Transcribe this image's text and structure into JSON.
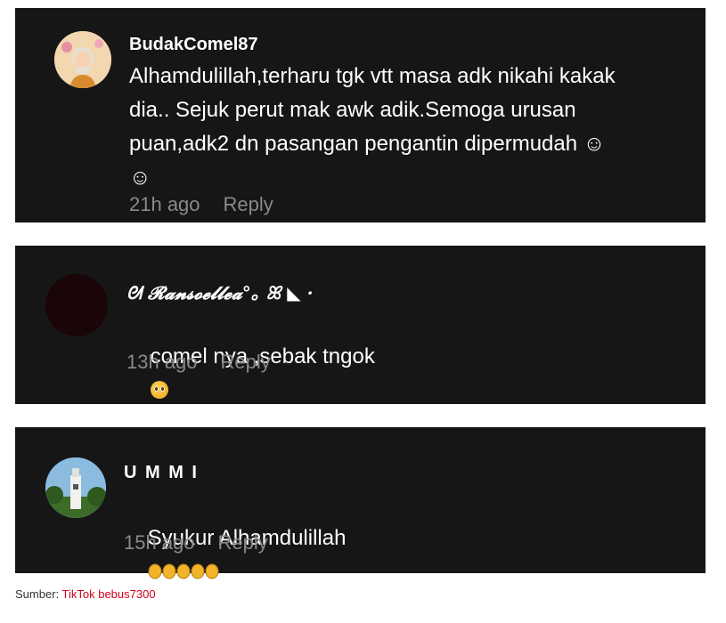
{
  "comments": [
    {
      "username": "BudakComel87",
      "text": "Alhamdulillah,terharu tgk vtt masa adk nikahi kakak\ndia.. Sejuk perut mak awk adik.Semoga urusan\npuan,adk2 dn pasangan pengantin dipermudah ☺\n☺",
      "time": "21h ago",
      "reply": "Reply",
      "avatar_color": "#d9a25a"
    },
    {
      "username": "ᘛ 𝓡𝓪𝓷𝓼𝓸𝓮𝓵𝓵𝓮𝓪°｡ ꕤ ◣ ·",
      "text": "comel nya ,sebak tngok",
      "time": "13h ago",
      "reply": "Reply",
      "avatar_color": "#1a0508"
    },
    {
      "username": "U M M I",
      "text": "Syukur Alhamdulillah",
      "time": "15h ago",
      "reply": "Reply",
      "avatar_color": "#7fb0d8"
    }
  ],
  "source": {
    "label": "Sumber:",
    "link": "TikTok bebus7300"
  },
  "colors": {
    "card_background": "#161616",
    "meta_text": "#8a8a8a",
    "source_link": "#d0021b"
  }
}
